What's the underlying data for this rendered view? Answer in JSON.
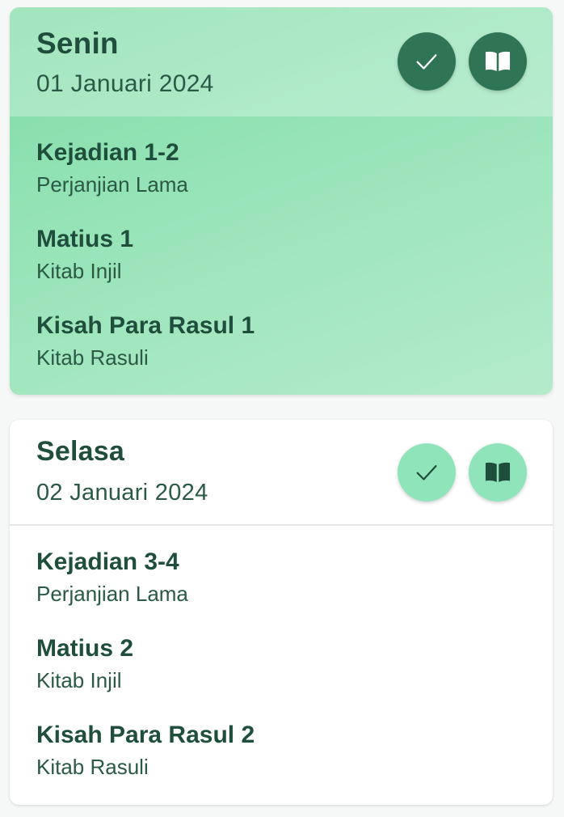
{
  "colors": {
    "text_primary": "#1f4f3c",
    "active_gradient_start": "#7fdba6",
    "active_gradient_end": "#b4ebcb",
    "active_button": "#2f7555",
    "inactive_button": "#8fe5b9",
    "card_bg": "#ffffff",
    "icon_on_active": "#ffffff",
    "icon_on_inactive": "#1f4f3c"
  },
  "days": [
    {
      "day": "Senin",
      "date": "01 Januari 2024",
      "state": "active",
      "buttons": {
        "check_icon": "checkmark-icon",
        "book_icon": "open-book-icon"
      },
      "readings": [
        {
          "title": "Kejadian 1-2",
          "subtitle": "Perjanjian Lama"
        },
        {
          "title": "Matius 1",
          "subtitle": "Kitab Injil"
        },
        {
          "title": "Kisah Para Rasul 1",
          "subtitle": "Kitab Rasuli"
        }
      ]
    },
    {
      "day": "Selasa",
      "date": "02 Januari 2024",
      "state": "inactive",
      "buttons": {
        "check_icon": "checkmark-icon",
        "book_icon": "open-book-icon"
      },
      "readings": [
        {
          "title": "Kejadian 3-4",
          "subtitle": "Perjanjian Lama"
        },
        {
          "title": "Matius 2",
          "subtitle": "Kitab Injil"
        },
        {
          "title": "Kisah Para Rasul 2",
          "subtitle": "Kitab Rasuli"
        }
      ]
    }
  ]
}
